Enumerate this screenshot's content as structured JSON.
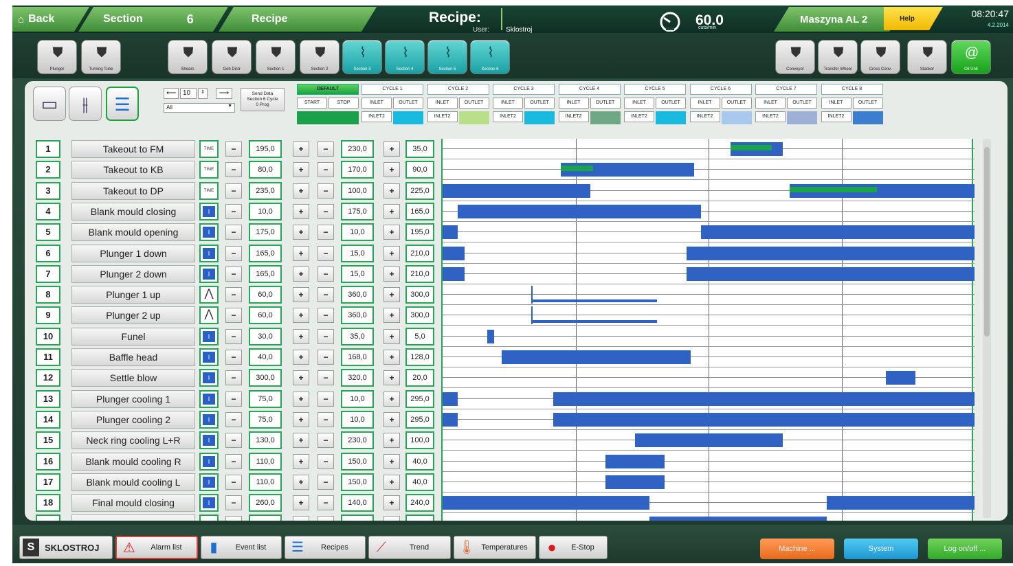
{
  "header": {
    "back": "Back",
    "section_label": "Section",
    "section_number": "6",
    "recipe_tab": "Recipe",
    "title": "Recipe:",
    "user_label": "User:",
    "user": "Sklostroj",
    "speed": "60.0",
    "speed_unit": "cuts/min",
    "machine": "Maszyna AL 2",
    "help": "Help",
    "time": "08:20:47",
    "date": "4.2.2014"
  },
  "toolbar": {
    "left": [
      "Plunger",
      "Turning Tube"
    ],
    "sections": [
      "Shears",
      "Gob Distr",
      "Section 1",
      "Section 2"
    ],
    "teal": [
      "Section 3",
      "Section 4",
      "Section 5",
      "Section 6"
    ],
    "right": [
      "Conveyor",
      "Transfer Wheel",
      "Cross Conv.",
      "Stacker",
      "Oil Unit"
    ]
  },
  "controls": {
    "step_value": "10",
    "filter": "All",
    "send_data": "Send Data",
    "send_data_line2": "Section 6 Cycle",
    "send_data_line3": "0 Prog"
  },
  "cycles": {
    "default_title": "DEFAULT",
    "start": "START",
    "stop": "STOP",
    "inlet": "INLET",
    "outlet": "OUTLET",
    "inlet2": "INLET2",
    "titles": [
      "CYCLE 1",
      "CYCLE 2",
      "CYCLE 3",
      "CYCLE 4",
      "CYCLE 5",
      "CYCLE 6",
      "CYCLE 7",
      "CYCLE 8"
    ],
    "colors": [
      "#19b9e0",
      "#b8e08a",
      "#19b9e0",
      "#6fa884",
      "#19b9e0",
      "#a9c8ee",
      "#9db0d6",
      "#3b7ed0"
    ]
  },
  "table": {
    "rows": [
      {
        "n": "1",
        "name": "Takeout to FM",
        "mode": "TIME",
        "a": "195,0",
        "b": "230,0",
        "c": "35,0"
      },
      {
        "n": "2",
        "name": "Takeout to KB",
        "mode": "TIME",
        "a": "80,0",
        "b": "170,0",
        "c": "90,0"
      },
      {
        "n": "3",
        "name": "Takeout to DP",
        "mode": "TIME",
        "a": "235,0",
        "b": "100,0",
        "c": "225,0"
      },
      {
        "n": "4",
        "name": "Blank mould closing",
        "mode": "block",
        "a": "10,0",
        "b": "175,0",
        "c": "165,0"
      },
      {
        "n": "5",
        "name": "Blank mould opening",
        "mode": "block",
        "a": "175,0",
        "b": "10,0",
        "c": "195,0"
      },
      {
        "n": "6",
        "name": "Plunger 1 down",
        "mode": "block",
        "a": "165,0",
        "b": "15,0",
        "c": "210,0"
      },
      {
        "n": "7",
        "name": "Plunger 2 down",
        "mode": "block",
        "a": "165,0",
        "b": "15,0",
        "c": "210,0"
      },
      {
        "n": "8",
        "name": "Plunger 1 up",
        "mode": "cam",
        "a": "60,0",
        "b": "360,0",
        "c": "300,0"
      },
      {
        "n": "9",
        "name": "Plunger 2 up",
        "mode": "cam",
        "a": "60,0",
        "b": "360,0",
        "c": "300,0"
      },
      {
        "n": "10",
        "name": "Funel",
        "mode": "block",
        "a": "30,0",
        "b": "35,0",
        "c": "5,0"
      },
      {
        "n": "11",
        "name": "Baffle head",
        "mode": "block",
        "a": "40,0",
        "b": "168,0",
        "c": "128,0"
      },
      {
        "n": "12",
        "name": "Settle blow",
        "mode": "block",
        "a": "300,0",
        "b": "320,0",
        "c": "20,0"
      },
      {
        "n": "13",
        "name": "Plunger cooling 1",
        "mode": "block",
        "a": "75,0",
        "b": "10,0",
        "c": "295,0"
      },
      {
        "n": "14",
        "name": "Plunger cooling 2",
        "mode": "block",
        "a": "75,0",
        "b": "10,0",
        "c": "295,0"
      },
      {
        "n": "15",
        "name": "Neck ring cooling L+R",
        "mode": "block",
        "a": "130,0",
        "b": "230,0",
        "c": "100,0"
      },
      {
        "n": "16",
        "name": "Blank mould cooling R",
        "mode": "block",
        "a": "110,0",
        "b": "150,0",
        "c": "40,0"
      },
      {
        "n": "17",
        "name": "Blank mould cooling L",
        "mode": "block",
        "a": "110,0",
        "b": "150,0",
        "c": "40,0"
      },
      {
        "n": "18",
        "name": "Final mould closing",
        "mode": "block",
        "a": "260,0",
        "b": "140,0",
        "c": "240,0"
      }
    ]
  },
  "bottom": {
    "brand": "SKLOSTROJ",
    "alarm": "Alarm list",
    "event": "Event list",
    "recipes": "Recipes",
    "trend": "Trend",
    "temps": "Temperatures",
    "estop": "E-Stop",
    "machine": "Machine ...",
    "system": "System",
    "logon": "Log on/off ..."
  },
  "colors": {
    "accent_green": "#25a45a",
    "bar_blue": "#2f62c2",
    "teal": "#1aa0a4"
  }
}
